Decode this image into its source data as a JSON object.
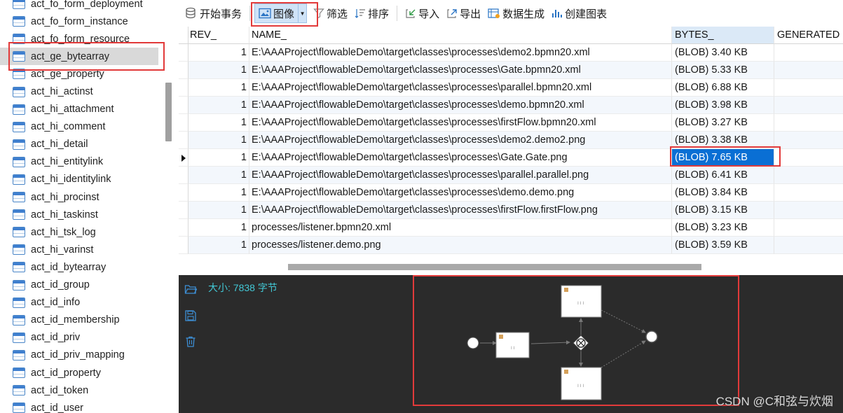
{
  "tree": {
    "items": [
      {
        "label": "act_fo_form_deployment",
        "selected": false
      },
      {
        "label": "act_fo_form_instance",
        "selected": false
      },
      {
        "label": "act_fo_form_resource",
        "selected": false
      },
      {
        "label": "act_ge_bytearray",
        "selected": true
      },
      {
        "label": "act_ge_property",
        "selected": false
      },
      {
        "label": "act_hi_actinst",
        "selected": false
      },
      {
        "label": "act_hi_attachment",
        "selected": false
      },
      {
        "label": "act_hi_comment",
        "selected": false
      },
      {
        "label": "act_hi_detail",
        "selected": false
      },
      {
        "label": "act_hi_entitylink",
        "selected": false
      },
      {
        "label": "act_hi_identitylink",
        "selected": false
      },
      {
        "label": "act_hi_procinst",
        "selected": false
      },
      {
        "label": "act_hi_taskinst",
        "selected": false
      },
      {
        "label": "act_hi_tsk_log",
        "selected": false
      },
      {
        "label": "act_hi_varinst",
        "selected": false
      },
      {
        "label": "act_id_bytearray",
        "selected": false
      },
      {
        "label": "act_id_group",
        "selected": false
      },
      {
        "label": "act_id_info",
        "selected": false
      },
      {
        "label": "act_id_membership",
        "selected": false
      },
      {
        "label": "act_id_priv",
        "selected": false
      },
      {
        "label": "act_id_priv_mapping",
        "selected": false
      },
      {
        "label": "act_id_property",
        "selected": false
      },
      {
        "label": "act_id_token",
        "selected": false
      },
      {
        "label": "act_id_user",
        "selected": false
      }
    ]
  },
  "toolbar": {
    "begin_transaction": "开始事务",
    "image": "图像",
    "filter": "筛选",
    "sort": "排序",
    "import": "导入",
    "export": "导出",
    "data_generation": "数据生成",
    "create_chart": "创建图表"
  },
  "grid": {
    "columns": [
      "REV_",
      "NAME_",
      "BYTES_",
      "GENERATED"
    ],
    "rows": [
      {
        "rev": "1",
        "name": "E:\\AAAProject\\flowableDemo\\target\\classes\\processes\\demo2.bpmn20.xml",
        "bytes": "(BLOB) 3.40 KB",
        "gen": ""
      },
      {
        "rev": "1",
        "name": "E:\\AAAProject\\flowableDemo\\target\\classes\\processes\\Gate.bpmn20.xml",
        "bytes": "(BLOB) 5.33 KB",
        "gen": ""
      },
      {
        "rev": "1",
        "name": "E:\\AAAProject\\flowableDemo\\target\\classes\\processes\\parallel.bpmn20.xml",
        "bytes": "(BLOB) 6.88 KB",
        "gen": ""
      },
      {
        "rev": "1",
        "name": "E:\\AAAProject\\flowableDemo\\target\\classes\\processes\\demo.bpmn20.xml",
        "bytes": "(BLOB) 3.98 KB",
        "gen": ""
      },
      {
        "rev": "1",
        "name": "E:\\AAAProject\\flowableDemo\\target\\classes\\processes\\firstFlow.bpmn20.xml",
        "bytes": "(BLOB) 3.27 KB",
        "gen": ""
      },
      {
        "rev": "1",
        "name": "E:\\AAAProject\\flowableDemo\\target\\classes\\processes\\demo2.demo2.png",
        "bytes": "(BLOB) 3.38 KB",
        "gen": ""
      },
      {
        "rev": "1",
        "name": "E:\\AAAProject\\flowableDemo\\target\\classes\\processes\\Gate.Gate.png",
        "bytes": "(BLOB) 7.65 KB",
        "gen": "",
        "current": true
      },
      {
        "rev": "1",
        "name": "E:\\AAAProject\\flowableDemo\\target\\classes\\processes\\parallel.parallel.png",
        "bytes": "(BLOB) 6.41 KB",
        "gen": ""
      },
      {
        "rev": "1",
        "name": "E:\\AAAProject\\flowableDemo\\target\\classes\\processes\\demo.demo.png",
        "bytes": "(BLOB) 3.84 KB",
        "gen": ""
      },
      {
        "rev": "1",
        "name": "E:\\AAAProject\\flowableDemo\\target\\classes\\processes\\firstFlow.firstFlow.png",
        "bytes": "(BLOB) 3.15 KB",
        "gen": ""
      },
      {
        "rev": "1",
        "name": "processes/listener.bpmn20.xml",
        "bytes": "(BLOB) 3.23 KB",
        "gen": ""
      },
      {
        "rev": "1",
        "name": "processes/listener.demo.png",
        "bytes": "(BLOB) 3.59 KB",
        "gen": ""
      }
    ]
  },
  "viewer": {
    "size_label": "大小: 7838 字节",
    "diagram": {
      "task_top_label": "꒐꒐꒐",
      "task_left_label": "꒐꒐",
      "task_bottom_label": "꒐꒐꒐"
    }
  },
  "watermark": "CSDN @C和弦与炊烟",
  "colors": {
    "selection": "#0a6fd4",
    "highlight": "#e23a3a",
    "viewer_bg": "#2b2b2b",
    "size_text": "#42c8d6"
  }
}
